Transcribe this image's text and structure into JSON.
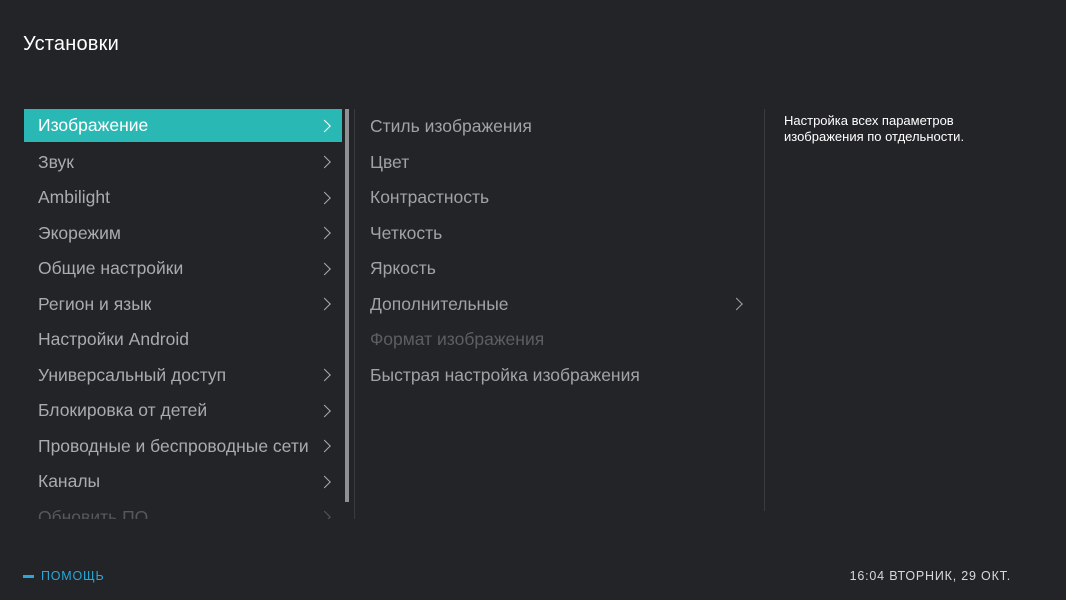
{
  "header": {
    "title": "Установки"
  },
  "menu": {
    "items": [
      {
        "label": "Изображение",
        "has_arrow": true,
        "selected": true
      },
      {
        "label": "Звук",
        "has_arrow": true
      },
      {
        "label": "Ambilight",
        "has_arrow": true
      },
      {
        "label": "Экорежим",
        "has_arrow": true
      },
      {
        "label": "Общие настройки",
        "has_arrow": true
      },
      {
        "label": "Регион и язык",
        "has_arrow": true
      },
      {
        "label": "Настройки Android",
        "has_arrow": false
      },
      {
        "label": "Универсальный доступ",
        "has_arrow": true
      },
      {
        "label": "Блокировка от детей",
        "has_arrow": true
      },
      {
        "label": "Проводные и беспроводные сети",
        "has_arrow": true
      },
      {
        "label": "Каналы",
        "has_arrow": true
      },
      {
        "label": "Обновить ПО",
        "has_arrow": true,
        "faded": true
      }
    ]
  },
  "submenu": {
    "items": [
      {
        "label": "Стиль изображения"
      },
      {
        "label": "Цвет"
      },
      {
        "label": "Контрастность"
      },
      {
        "label": "Четкость"
      },
      {
        "label": "Яркость"
      },
      {
        "label": "Дополнительные",
        "has_arrow": true
      },
      {
        "label": "Формат изображения",
        "disabled": true
      },
      {
        "label": "Быстрая настройка изображения"
      }
    ]
  },
  "description": {
    "text": "Настройка всех параметров изображения по отдельности."
  },
  "footer": {
    "help_label": "ПОМОЩЬ",
    "clock": "16:04 ВТОРНИК, 29 ОКТ."
  },
  "colors": {
    "background": "#232427",
    "accent": "#2ab8b4",
    "help_key": "#29a7d8"
  },
  "icons": {
    "menu_arrow": "chevron-right-icon",
    "help_key": "blue-key-icon"
  }
}
